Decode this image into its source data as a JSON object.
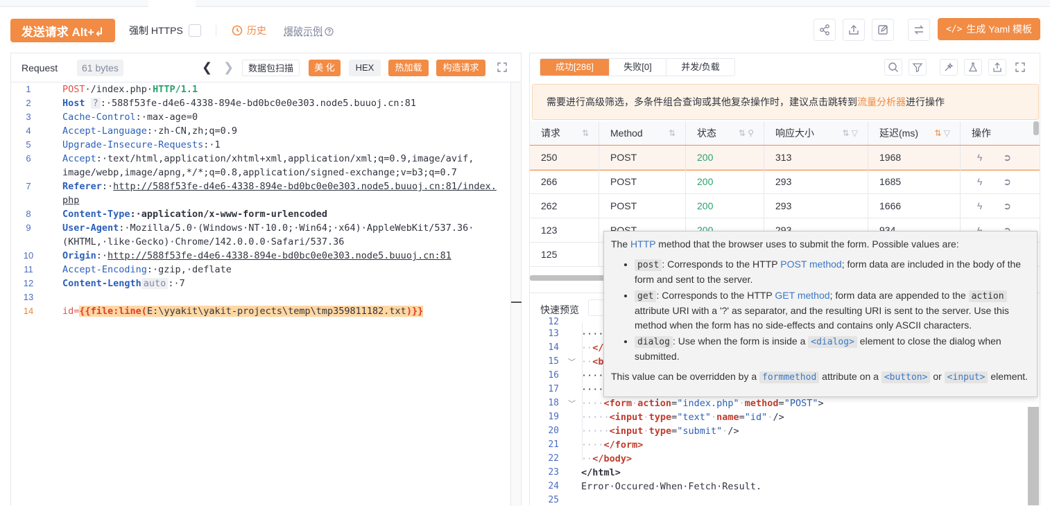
{
  "toolbar": {
    "send_label": "发送请求 Alt+↲",
    "force_https_label": "强制 HTTPS",
    "history_label": "历史",
    "fuzz_example_label": "爆破示例",
    "yaml_label": "生成 Yaml 模板"
  },
  "request": {
    "title": "Request",
    "bytes": "61 bytes",
    "buttons": {
      "scan": "数据包扫描",
      "beautify": "美 化",
      "hex": "HEX",
      "hotload": "热加载",
      "construct": "构造请求"
    },
    "lines": [
      {
        "no": "1"
      },
      {
        "no": "2"
      },
      {
        "no": "3"
      },
      {
        "no": "4"
      },
      {
        "no": "5"
      },
      {
        "no": "6"
      },
      {
        "no": "7"
      },
      {
        "no": "8"
      },
      {
        "no": "9"
      },
      {
        "no": "10"
      },
      {
        "no": "11"
      },
      {
        "no": "12"
      },
      {
        "no": "13"
      },
      {
        "no": "14"
      }
    ],
    "code": {
      "l1_method": "POST",
      "l1_path": "·/index.php·",
      "l1_proto": "HTTP/1.1",
      "l2_key": "Host",
      "l2_hint": "?",
      "l2_val": ":·588f53fe-d4e6-4338-894e-bd0bc0e0e303.node5.buuoj.cn:81",
      "l3_key": "Cache-Control",
      "l3_val": ":·max-age=0",
      "l4_key": "Accept-Language",
      "l4_val": ":·zh-CN,zh;q=0.9",
      "l5_key": "Upgrade-Insecure-Requests",
      "l5_val": ":·1",
      "l6_key": "Accept",
      "l6_val": ":·text/html,application/xhtml+xml,application/xml;q=0.9,image/avif,",
      "l6b": "image/webp,image/apng,*/*;q=0.8,application/signed-exchange;v=b3;q=0.7",
      "l7_key": "Referer",
      "l7_sep": ":·",
      "l7_url": "http://588f53fe-d4e6-4338-894e-bd0bc0e0e303.node5.buuoj.cn:81/index.",
      "l7b": "php",
      "l8_key": "Content-Type",
      "l8_val": ":·application/x-www-form-urlencoded",
      "l9_key": "User-Agent",
      "l9_val": ":·Mozilla/5.0·(Windows·NT·10.0;·Win64;·x64)·AppleWebKit/537.36·",
      "l9b": "(KHTML,·like·Gecko)·Chrome/142.0.0.0·Safari/537.36",
      "l10_key": "Origin",
      "l10_sep": ":·",
      "l10_url": "http://588f53fe-d4e6-4338-894e-bd0bc0e0e303.node5.buuoj.cn:81",
      "l11_key": "Accept-Encoding",
      "l11_val": ":·gzip,·deflate",
      "l12_key": "Content-Length",
      "l12_hint": "auto",
      "l12_val": ":·7",
      "l14_pre": "id=",
      "l14_fuzz_open": "{{file:line(",
      "l14_path": "E:\\yyakit\\yakit-projects\\temp\\tmp359811182.txt",
      "l14_fuzz_close": ")}}"
    }
  },
  "response": {
    "tabs": {
      "success": "成功[286]",
      "fail": "失败[0]",
      "concurrency": "并发/负载"
    },
    "notice_pre": "需要进行高级筛选，多条件组合查询或其他复杂操作时，建议点击跳转到",
    "notice_link": "流量分析器",
    "notice_post": "进行操作",
    "columns": {
      "req": "请求",
      "method": "Method",
      "status": "状态",
      "size": "响应大小",
      "delay": "延迟(ms)",
      "ops": "操作"
    },
    "rows": [
      {
        "req": "250",
        "method": "POST",
        "status": "200",
        "size": "313",
        "delay": "1968"
      },
      {
        "req": "266",
        "method": "POST",
        "status": "200",
        "size": "293",
        "delay": "1685"
      },
      {
        "req": "262",
        "method": "POST",
        "status": "200",
        "size": "293",
        "delay": "1666"
      },
      {
        "req": "123",
        "method": "POST",
        "status": "200",
        "size": "293",
        "delay": "934"
      },
      {
        "req": "125",
        "method": "",
        "status": "",
        "size": "",
        "delay": ""
      }
    ],
    "preview_label": "快速预览",
    "code_lines": {
      "n12": "12",
      "n13": "13",
      "n14": "14",
      "n15": "15",
      "n16": "16",
      "n17": "17",
      "n18": "18",
      "n19": "19",
      "n20": "20",
      "n21": "21",
      "n22": "22",
      "n23": "23",
      "n24": "24",
      "n25": "25",
      "t14": "</",
      "t15": "<b",
      "t18_open": "<form",
      "t18_a1": "action",
      "t18_v1": "\"index.php\"",
      "t18_a2": "method",
      "t18_v2": "\"POST\"",
      "t18_close": ">",
      "t19_open": "<input",
      "t19_a1": "type",
      "t19_v1": "\"text\"",
      "t19_a2": "name",
      "t19_v2": "\"id\"",
      "t19_close": "/>",
      "t20_open": "<input",
      "t20_a1": "type",
      "t20_v1": "\"submit\"",
      "t20_close": "/>",
      "t21": "</form>",
      "t22": "</body>",
      "t23": "</html>",
      "t24": "Error·Occured·When·Fetch·Result."
    }
  },
  "tooltip": {
    "intro_pre": "The ",
    "intro_link": "HTTP",
    "intro_post": " method that the browser uses to submit the form. Possible values are:",
    "post_code": "post",
    "post_pre": ": Corresponds to the HTTP ",
    "post_link": "POST method",
    "post_post": "; form data are included in the body of the form and sent to the server.",
    "get_code": "get",
    "get_pre": ": Corresponds to the HTTP ",
    "get_link": "GET method",
    "get_mid": "; form data are appended to the ",
    "get_code2": "action",
    "get_post": " attribute URI with a '?' as separator, and the resulting URI is sent to the server. Use this method when the form has no side-effects and contains only ASCII characters.",
    "dialog_code": "dialog",
    "dialog_pre": ": Use when the form is inside a ",
    "dialog_code2": "<dialog>",
    "dialog_post": " element to close the dialog when submitted.",
    "outro_pre": "This value can be overridden by a ",
    "outro_code1": "formmethod",
    "outro_mid": " attribute on a ",
    "outro_code2": "<button>",
    "outro_or": " or ",
    "outro_code3": "<input>",
    "outro_post": " element."
  }
}
